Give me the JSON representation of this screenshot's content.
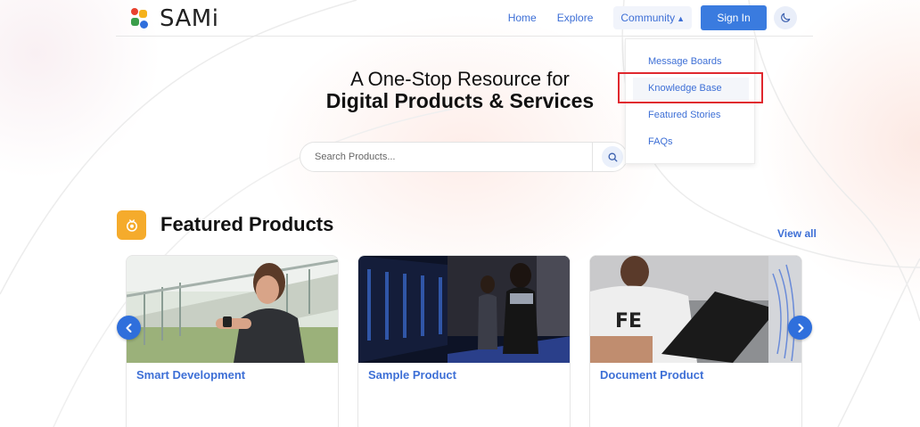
{
  "brand": {
    "name": "SAMi",
    "logo_colors": [
      "#e8412e",
      "#f5b21b",
      "#3a9e4a",
      "#2f6fdc"
    ]
  },
  "nav": {
    "home": "Home",
    "explore": "Explore",
    "community": "Community",
    "signin": "Sign In"
  },
  "community_menu": {
    "items": [
      "Message Boards",
      "Knowledge Base",
      "Featured Stories",
      "FAQs"
    ],
    "highlighted": "Knowledge Base"
  },
  "hero": {
    "line1": "A One-Stop Resource for",
    "line2": "Digital Products & Services"
  },
  "search": {
    "placeholder": "Search Products..."
  },
  "featured": {
    "title": "Featured Products",
    "view_all": "View all",
    "cards": [
      {
        "title": "Smart Development"
      },
      {
        "title": "Sample Product"
      },
      {
        "title": "Document Product"
      }
    ]
  },
  "colors": {
    "accent": "#3a7bdf",
    "link": "#3d6fd6",
    "featured_icon": "#f5ab2c",
    "annotation": "#e0282e"
  }
}
